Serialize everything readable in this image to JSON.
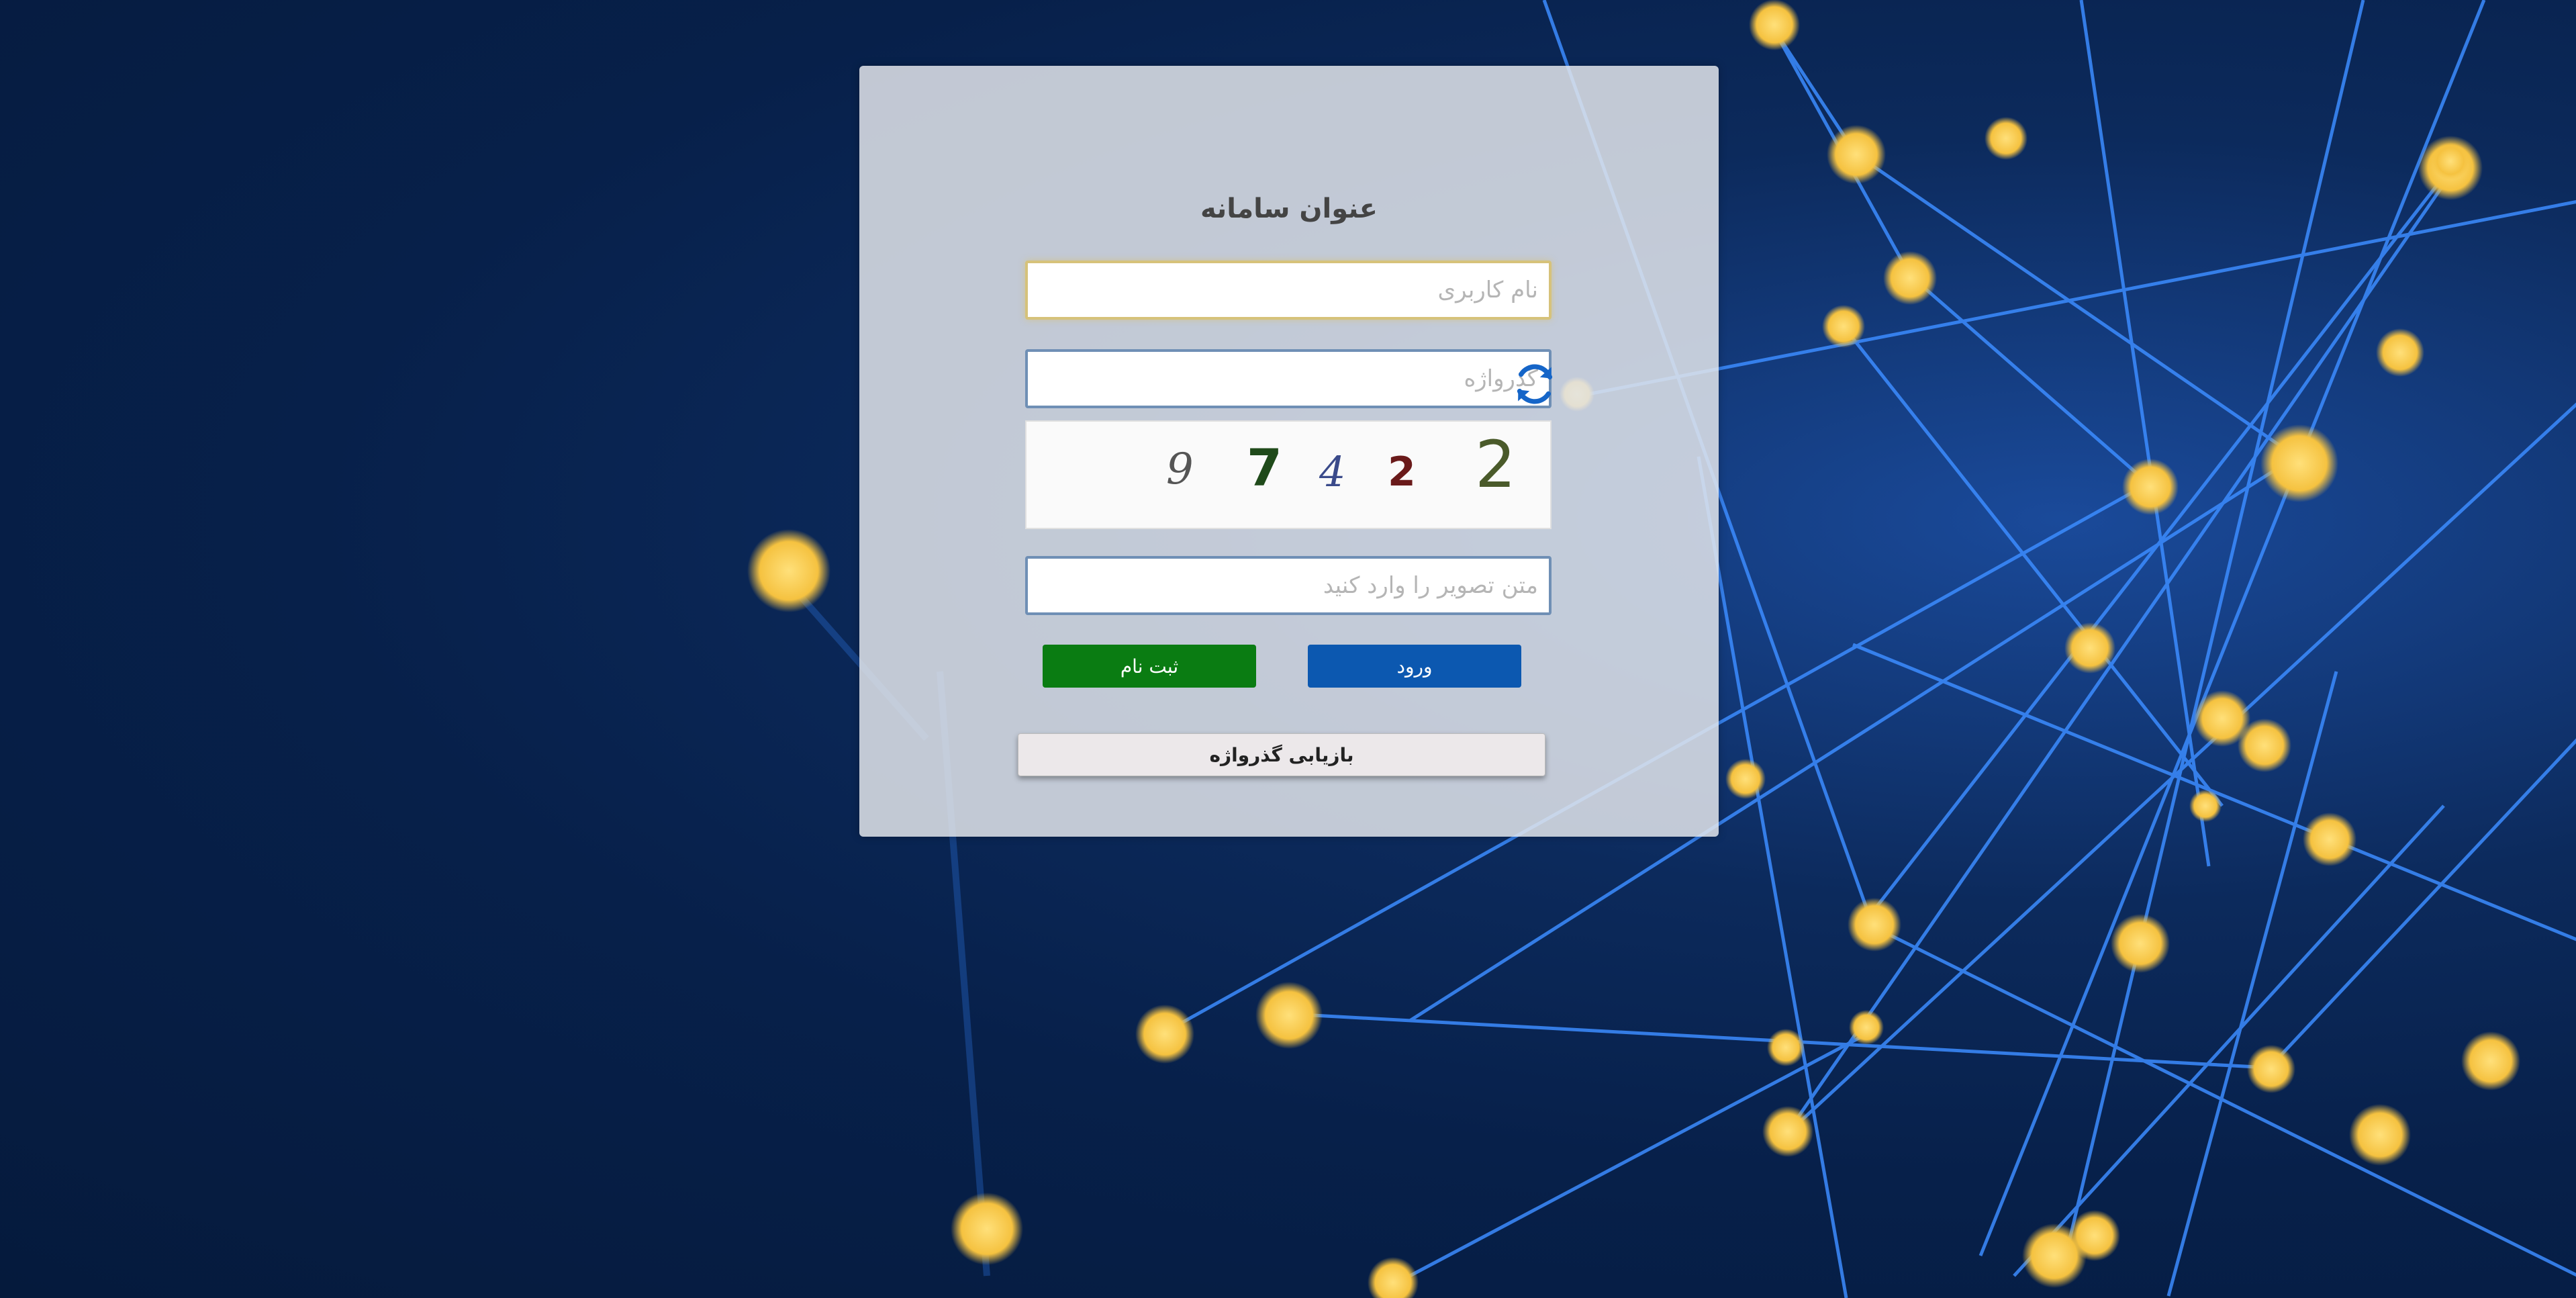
{
  "login": {
    "title": "عنوان سامانه",
    "username_placeholder": "نام کاربری",
    "password_placeholder": "گذرواژه",
    "captcha_placeholder": "متن تصویر را وارد کنید",
    "captcha_digits": [
      "9",
      "7",
      "4",
      "2",
      "2"
    ],
    "login_label": "ورود",
    "register_label": "ثبت نام",
    "recover_label": "بازیابی گذرواژه"
  },
  "colors": {
    "login_button": "#0c58b0",
    "register_button": "#0a7c12",
    "refresh_icon": "#1565c8"
  },
  "icons": {
    "refresh": "refresh-icon"
  }
}
